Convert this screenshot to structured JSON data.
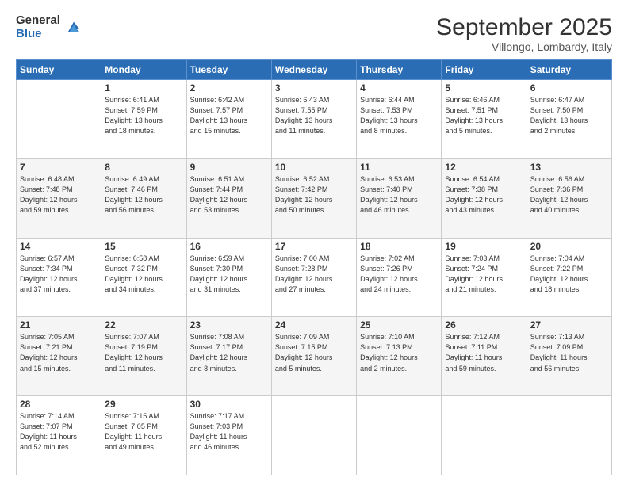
{
  "logo": {
    "general": "General",
    "blue": "Blue"
  },
  "header": {
    "title": "September 2025",
    "location": "Villongo, Lombardy, Italy"
  },
  "weekdays": [
    "Sunday",
    "Monday",
    "Tuesday",
    "Wednesday",
    "Thursday",
    "Friday",
    "Saturday"
  ],
  "weeks": [
    [
      {
        "day": "",
        "info": ""
      },
      {
        "day": "1",
        "info": "Sunrise: 6:41 AM\nSunset: 7:59 PM\nDaylight: 13 hours\nand 18 minutes."
      },
      {
        "day": "2",
        "info": "Sunrise: 6:42 AM\nSunset: 7:57 PM\nDaylight: 13 hours\nand 15 minutes."
      },
      {
        "day": "3",
        "info": "Sunrise: 6:43 AM\nSunset: 7:55 PM\nDaylight: 13 hours\nand 11 minutes."
      },
      {
        "day": "4",
        "info": "Sunrise: 6:44 AM\nSunset: 7:53 PM\nDaylight: 13 hours\nand 8 minutes."
      },
      {
        "day": "5",
        "info": "Sunrise: 6:46 AM\nSunset: 7:51 PM\nDaylight: 13 hours\nand 5 minutes."
      },
      {
        "day": "6",
        "info": "Sunrise: 6:47 AM\nSunset: 7:50 PM\nDaylight: 13 hours\nand 2 minutes."
      }
    ],
    [
      {
        "day": "7",
        "info": "Sunrise: 6:48 AM\nSunset: 7:48 PM\nDaylight: 12 hours\nand 59 minutes."
      },
      {
        "day": "8",
        "info": "Sunrise: 6:49 AM\nSunset: 7:46 PM\nDaylight: 12 hours\nand 56 minutes."
      },
      {
        "day": "9",
        "info": "Sunrise: 6:51 AM\nSunset: 7:44 PM\nDaylight: 12 hours\nand 53 minutes."
      },
      {
        "day": "10",
        "info": "Sunrise: 6:52 AM\nSunset: 7:42 PM\nDaylight: 12 hours\nand 50 minutes."
      },
      {
        "day": "11",
        "info": "Sunrise: 6:53 AM\nSunset: 7:40 PM\nDaylight: 12 hours\nand 46 minutes."
      },
      {
        "day": "12",
        "info": "Sunrise: 6:54 AM\nSunset: 7:38 PM\nDaylight: 12 hours\nand 43 minutes."
      },
      {
        "day": "13",
        "info": "Sunrise: 6:56 AM\nSunset: 7:36 PM\nDaylight: 12 hours\nand 40 minutes."
      }
    ],
    [
      {
        "day": "14",
        "info": "Sunrise: 6:57 AM\nSunset: 7:34 PM\nDaylight: 12 hours\nand 37 minutes."
      },
      {
        "day": "15",
        "info": "Sunrise: 6:58 AM\nSunset: 7:32 PM\nDaylight: 12 hours\nand 34 minutes."
      },
      {
        "day": "16",
        "info": "Sunrise: 6:59 AM\nSunset: 7:30 PM\nDaylight: 12 hours\nand 31 minutes."
      },
      {
        "day": "17",
        "info": "Sunrise: 7:00 AM\nSunset: 7:28 PM\nDaylight: 12 hours\nand 27 minutes."
      },
      {
        "day": "18",
        "info": "Sunrise: 7:02 AM\nSunset: 7:26 PM\nDaylight: 12 hours\nand 24 minutes."
      },
      {
        "day": "19",
        "info": "Sunrise: 7:03 AM\nSunset: 7:24 PM\nDaylight: 12 hours\nand 21 minutes."
      },
      {
        "day": "20",
        "info": "Sunrise: 7:04 AM\nSunset: 7:22 PM\nDaylight: 12 hours\nand 18 minutes."
      }
    ],
    [
      {
        "day": "21",
        "info": "Sunrise: 7:05 AM\nSunset: 7:21 PM\nDaylight: 12 hours\nand 15 minutes."
      },
      {
        "day": "22",
        "info": "Sunrise: 7:07 AM\nSunset: 7:19 PM\nDaylight: 12 hours\nand 11 minutes."
      },
      {
        "day": "23",
        "info": "Sunrise: 7:08 AM\nSunset: 7:17 PM\nDaylight: 12 hours\nand 8 minutes."
      },
      {
        "day": "24",
        "info": "Sunrise: 7:09 AM\nSunset: 7:15 PM\nDaylight: 12 hours\nand 5 minutes."
      },
      {
        "day": "25",
        "info": "Sunrise: 7:10 AM\nSunset: 7:13 PM\nDaylight: 12 hours\nand 2 minutes."
      },
      {
        "day": "26",
        "info": "Sunrise: 7:12 AM\nSunset: 7:11 PM\nDaylight: 11 hours\nand 59 minutes."
      },
      {
        "day": "27",
        "info": "Sunrise: 7:13 AM\nSunset: 7:09 PM\nDaylight: 11 hours\nand 56 minutes."
      }
    ],
    [
      {
        "day": "28",
        "info": "Sunrise: 7:14 AM\nSunset: 7:07 PM\nDaylight: 11 hours\nand 52 minutes."
      },
      {
        "day": "29",
        "info": "Sunrise: 7:15 AM\nSunset: 7:05 PM\nDaylight: 11 hours\nand 49 minutes."
      },
      {
        "day": "30",
        "info": "Sunrise: 7:17 AM\nSunset: 7:03 PM\nDaylight: 11 hours\nand 46 minutes."
      },
      {
        "day": "",
        "info": ""
      },
      {
        "day": "",
        "info": ""
      },
      {
        "day": "",
        "info": ""
      },
      {
        "day": "",
        "info": ""
      }
    ]
  ]
}
